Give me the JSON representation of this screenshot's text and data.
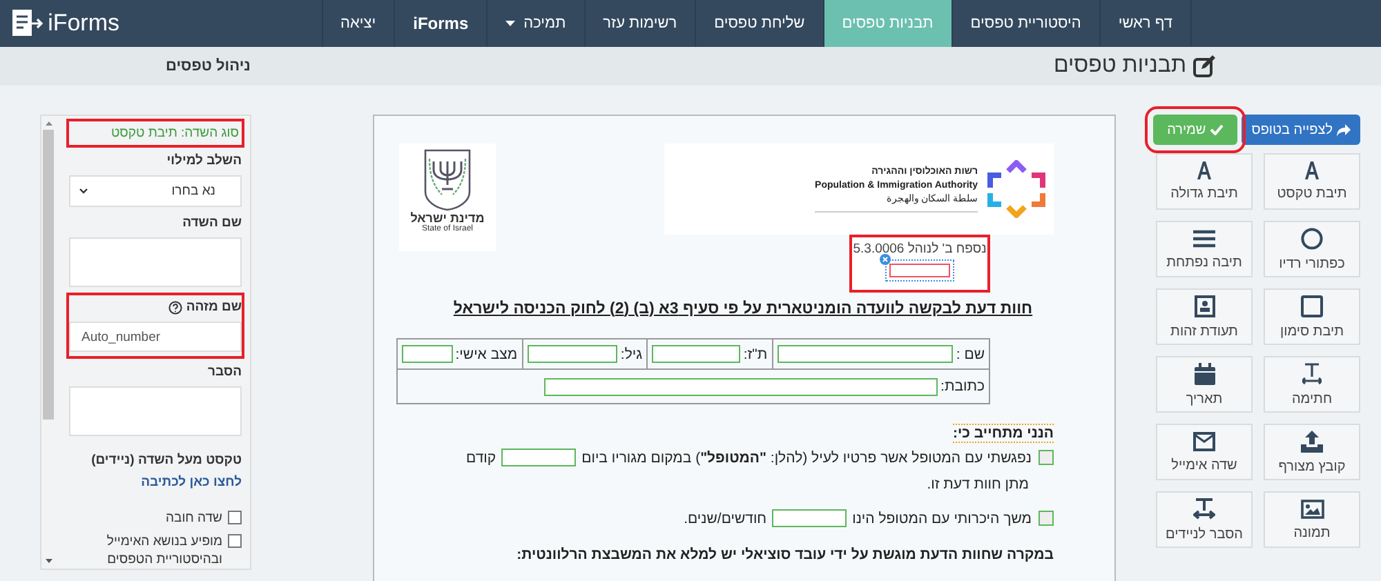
{
  "navbar": {
    "logo": "iForms",
    "items": [
      {
        "label": "דף ראשי",
        "selected": false,
        "kind": "link"
      },
      {
        "label": "היסטוריית טפסים",
        "selected": false,
        "kind": "link"
      },
      {
        "label": "תבניות טפסים",
        "selected": true,
        "kind": "link"
      },
      {
        "label": "שליחת טפסים",
        "selected": false,
        "kind": "link"
      },
      {
        "label": "רשימות עזר",
        "selected": false,
        "kind": "link"
      },
      {
        "label": "תמיכה",
        "selected": false,
        "kind": "dropdown"
      },
      {
        "label": "iForms",
        "selected": false,
        "kind": "brand"
      },
      {
        "label": "יציאה",
        "selected": false,
        "kind": "link"
      }
    ]
  },
  "page_header": {
    "title": "תבניות טפסים",
    "breadcrumb": "ניהול טפסים"
  },
  "toolbar": {
    "buttons": [
      {
        "label": "לצפייה בטופס",
        "kind": "view",
        "highlighted": false
      },
      {
        "label": "שמירה",
        "kind": "save",
        "highlighted": true
      }
    ],
    "tools": [
      {
        "label": "תיבת טקסט",
        "kind": "text"
      },
      {
        "label": "תיבת גדולה",
        "kind": "text"
      },
      {
        "label": "כפתורי רדיו",
        "kind": "radio"
      },
      {
        "label": "תיבה נפתחת",
        "kind": "list"
      },
      {
        "label": "תיבת סימון",
        "kind": "checkbox"
      },
      {
        "label": "תעודת זהות",
        "kind": "id"
      },
      {
        "label": "חתימה",
        "kind": "signature"
      },
      {
        "label": "תאריך",
        "kind": "date"
      },
      {
        "label": "קובץ מצורף",
        "kind": "upload"
      },
      {
        "label": "שדה אימייל",
        "kind": "email"
      },
      {
        "label": "תמונה",
        "kind": "image"
      },
      {
        "label": "הסבר לניידים",
        "kind": "mobile"
      }
    ]
  },
  "document": {
    "authority_logo": {
      "lines": [
        "רשות האוכלוסין וההגירה",
        "Population & Immigration Authority",
        "سلطة السكان والهجرة"
      ]
    },
    "emblem": {
      "lines": [
        "מדינת ישראל",
        "State of Israel"
      ]
    },
    "appendix": "נספח ב' לנוהל 5.3.0006",
    "selected_field": {
      "highlighted": true
    },
    "title": "חוות דעת לבקשה לוועדה הומניטארית על פי סעיף 3א (ב) (2) לחוק הכניסה לישראל",
    "table": {
      "row_1": [
        "שם :",
        "ת\"ז:",
        "גיל:",
        "מצב אישי:"
      ],
      "row_2": "כתובת:"
    },
    "commitment": "הנני מתחייב כי:",
    "checks": [
      {
        "checked": false,
        "parts": [
          {
            "kind": "text",
            "text": "נפגשתי עם המטופל אשר פרטיו לעיל (להלן: **\"המטופל\"**) במקום מגוריו ביום"
          },
          {
            "kind": "field"
          },
          {
            "kind": "text",
            "text": "קודם"
          }
        ],
        "continuation": "מתן חוות דעת זו."
      },
      {
        "checked": false,
        "parts": [
          {
            "kind": "text",
            "text": "משך היכרותי עם המטופל הינו"
          },
          {
            "kind": "field"
          },
          {
            "kind": "text",
            "text": "חודשים/שנים."
          }
        ]
      }
    ],
    "note": "במקרה שחוות הדעת מוגשת על ידי עובד סוציאלי יש  למלא את המשבצת הרלוונטית:"
  },
  "properties": {
    "field_type": {
      "text": "סוג השדה: תיבת טקסט",
      "highlighted": true
    },
    "stage": {
      "label": "השלב למילוי",
      "value": "נא בחרו"
    },
    "field_name": {
      "label": "שם השדה"
    },
    "identifier": {
      "label": "שם מזהה",
      "value": "Auto_number",
      "highlighted": true
    },
    "explanation": {
      "label": "הסבר"
    },
    "mobile_text": {
      "label": "טקסט מעל השדה (ניידים)",
      "link": "לחצו כאן לכתיבה"
    },
    "options": [
      {
        "label": "שדה חובה",
        "checked": false
      },
      {
        "label": "מופיע בנושא האימייל ובהיסטוריית הטפסים",
        "checked": false
      }
    ]
  }
}
